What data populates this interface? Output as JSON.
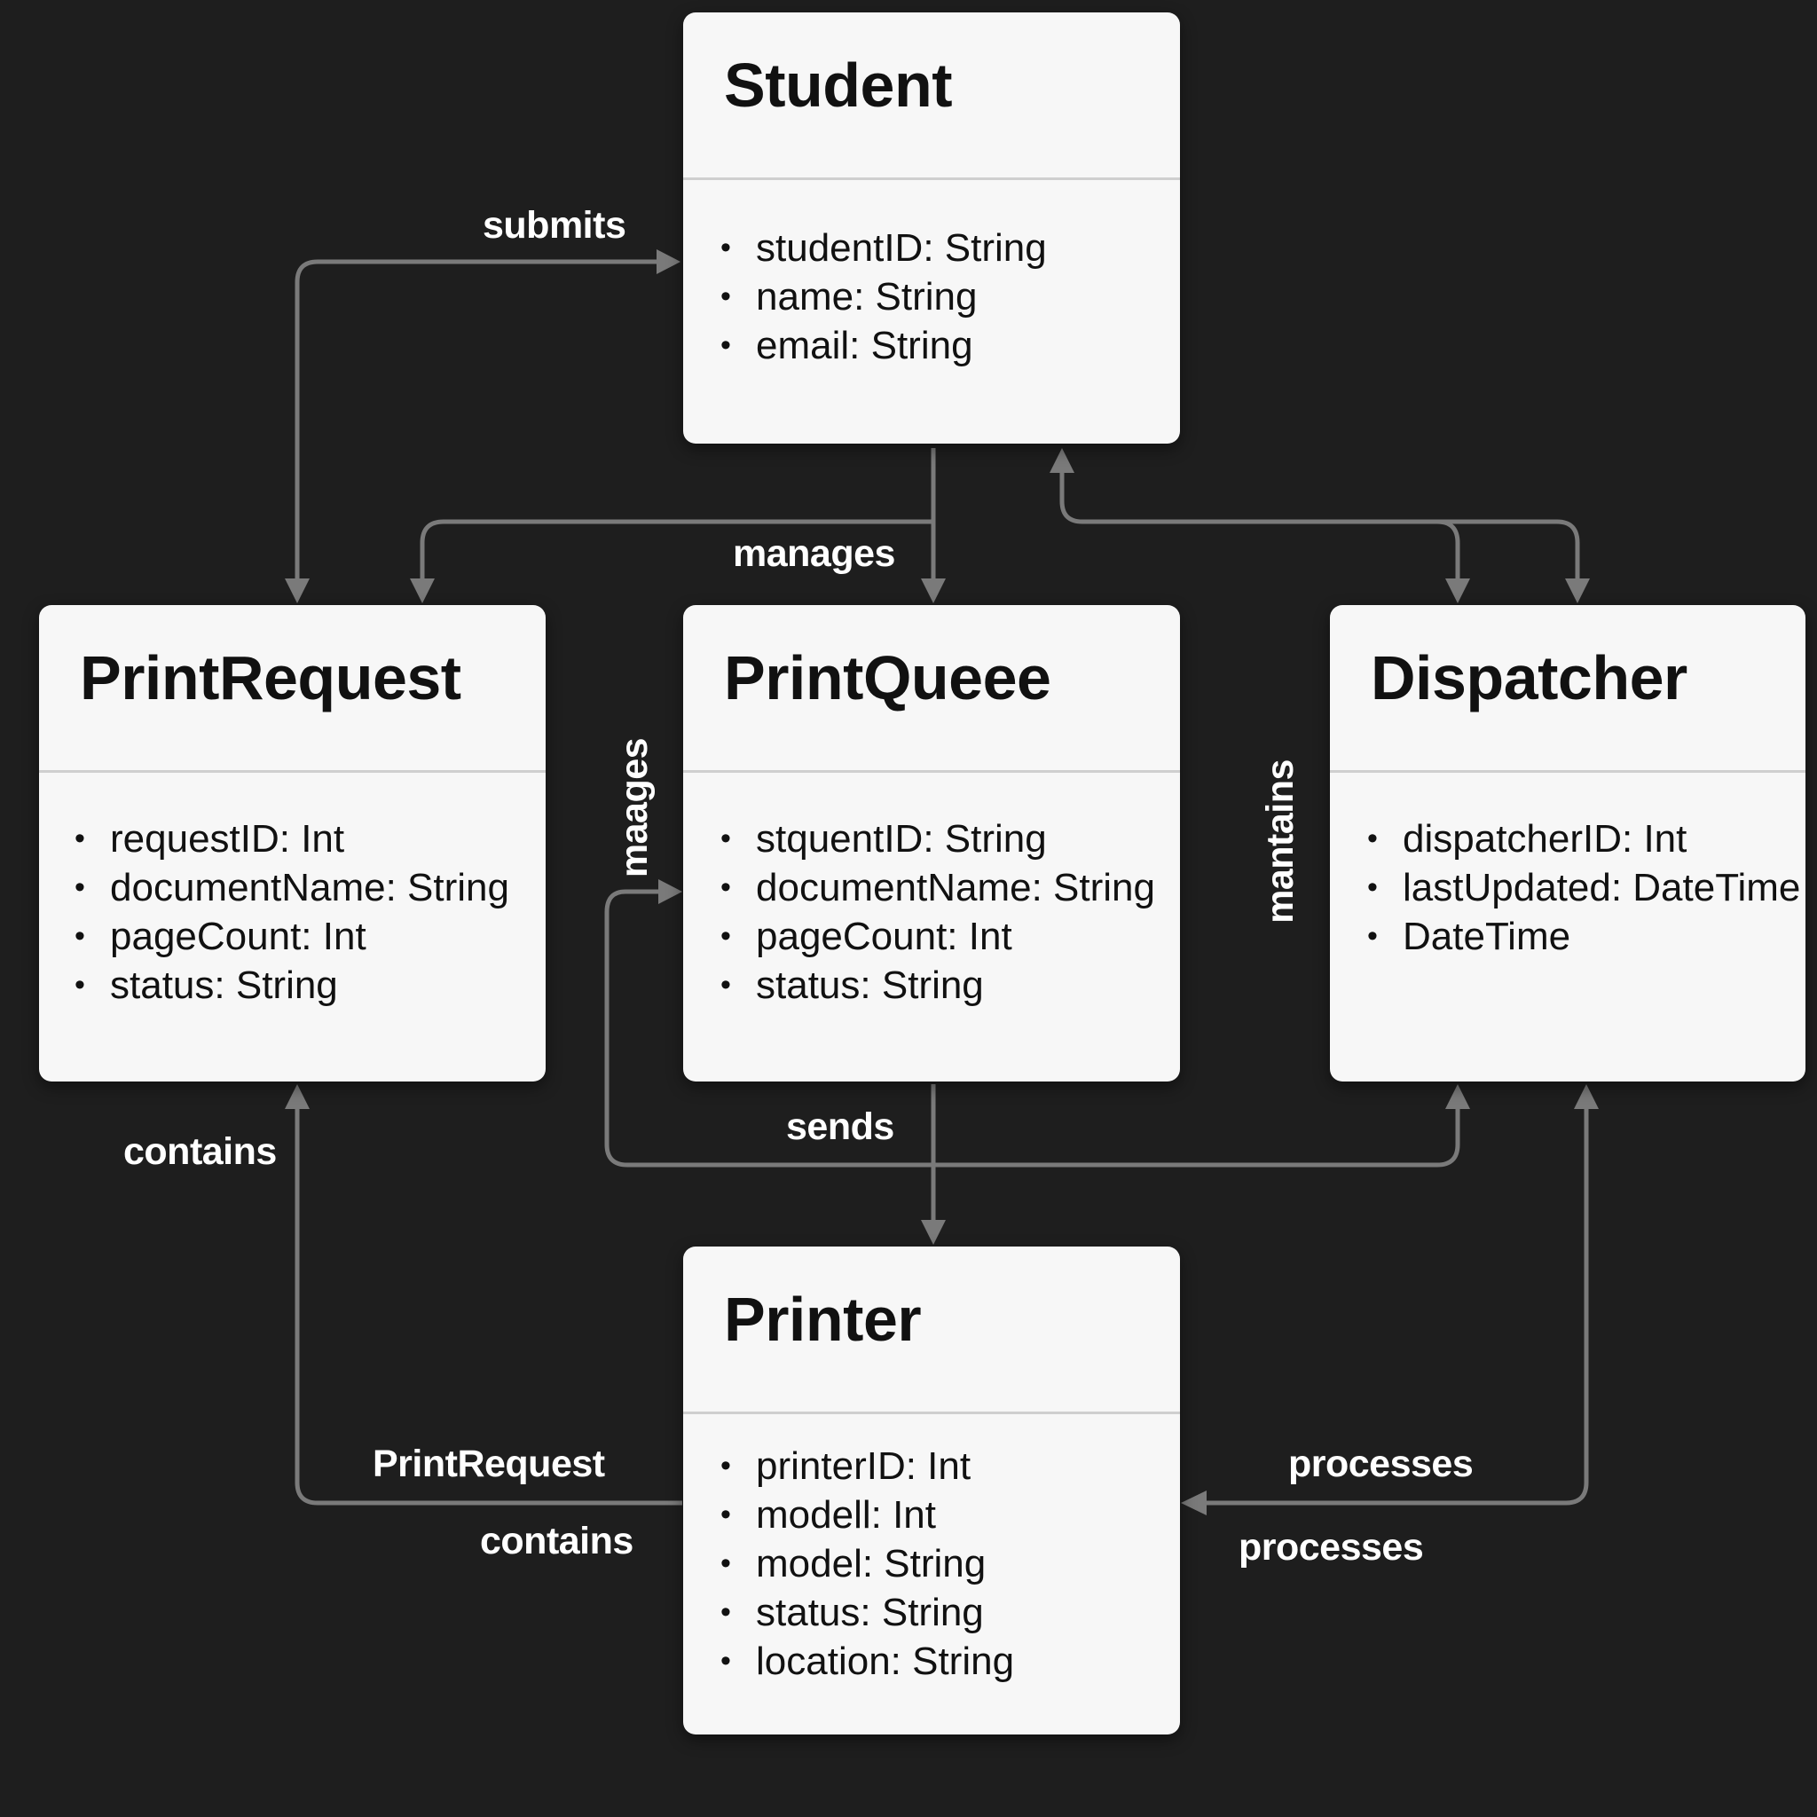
{
  "colors": {
    "background": "#1e1e1e",
    "card": "#f7f7f7",
    "connector": "#7a7a7a",
    "label": "#ffffff"
  },
  "classes": {
    "student": {
      "name": "Student",
      "attributes": [
        "studentID: String",
        "name: String",
        "email: String"
      ]
    },
    "print_request": {
      "name": "PrintRequest",
      "attributes": [
        "requestID: Int",
        "documentName: String",
        "pageCount: Int",
        "status: String"
      ]
    },
    "print_queue": {
      "name": "PrintQueee",
      "attributes": [
        "stquentID: String",
        "documentName: String",
        "pageCount: Int",
        "status: String"
      ]
    },
    "dispatcher": {
      "name": "Dispatcher",
      "attributes": [
        "dispatcherID: Int",
        "lastUpdated: DateTime",
        "DateTime"
      ]
    },
    "printer": {
      "name": "Printer",
      "attributes": [
        "printerID: Int",
        "modell: Int",
        "model: String",
        "status: String",
        "location: String"
      ]
    }
  },
  "relations": {
    "submits": "submits",
    "manages": "manages",
    "maages": "maages",
    "mantains": "mantains",
    "sends": "sends",
    "contains_left": "contains",
    "print_request": "PrintRequest",
    "contains_bottom": "contains",
    "processes_top": "processes",
    "processes_bottom": "processes"
  }
}
